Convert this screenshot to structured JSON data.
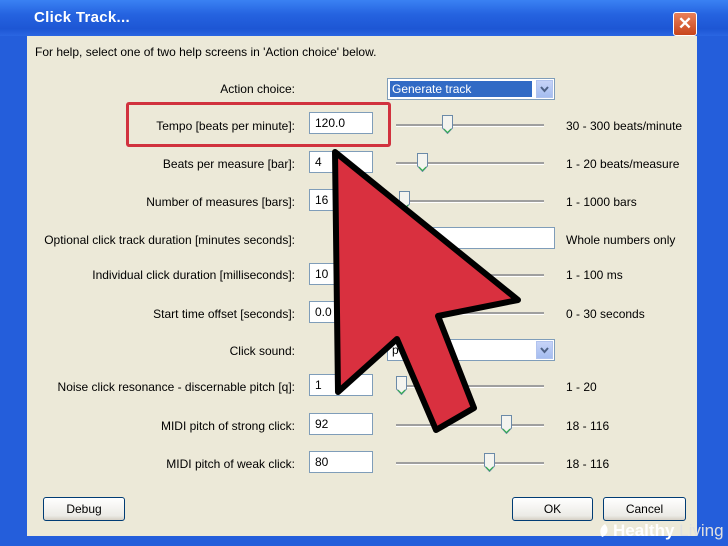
{
  "window": {
    "title": "Click Track..."
  },
  "help_text": "For help, select one of two help screens in 'Action choice' below.",
  "action_choice": {
    "label": "Action choice:",
    "value": "Generate track"
  },
  "rows": [
    {
      "label": "Tempo [beats per minute]:",
      "value": "120.0",
      "range": "30 - 300 beats/minute"
    },
    {
      "label": "Beats per measure [bar]:",
      "value": "4",
      "range": "1 - 20 beats/measure"
    },
    {
      "label": "Number of measures [bars]:",
      "value": "16",
      "range": "1 - 1000 bars"
    },
    {
      "label": "Optional click track duration [minutes seconds]:",
      "value": "",
      "range": "Whole numbers only"
    },
    {
      "label": "Individual click duration [milliseconds]:",
      "value": "10",
      "range": "1 - 100 ms"
    },
    {
      "label": "Start time offset [seconds]:",
      "value": "0.0",
      "range": "0 - 30 seconds"
    },
    {
      "label": "Click sound:",
      "value": "p",
      "range": ""
    },
    {
      "label": "Noise click resonance - discernable pitch [q]:",
      "value": "1",
      "range": "1 - 20"
    },
    {
      "label": "MIDI pitch of strong click:",
      "value": "92",
      "range": "18 - 116"
    },
    {
      "label": "MIDI pitch of weak click:",
      "value": "80",
      "range": "18 - 116"
    }
  ],
  "buttons": {
    "debug": "Debug",
    "ok": "OK",
    "cancel": "Cancel"
  },
  "watermark": {
    "brand": "Healthy",
    "suffix": " Living"
  },
  "colors": {
    "highlight_box": "#d1323e",
    "arrow_fill": "#d9303f",
    "title_bar": "#245edb"
  },
  "icons": {
    "close": "close-icon",
    "dropdown": "chevron-down-icon",
    "slider": "slider-thumb-icon"
  }
}
